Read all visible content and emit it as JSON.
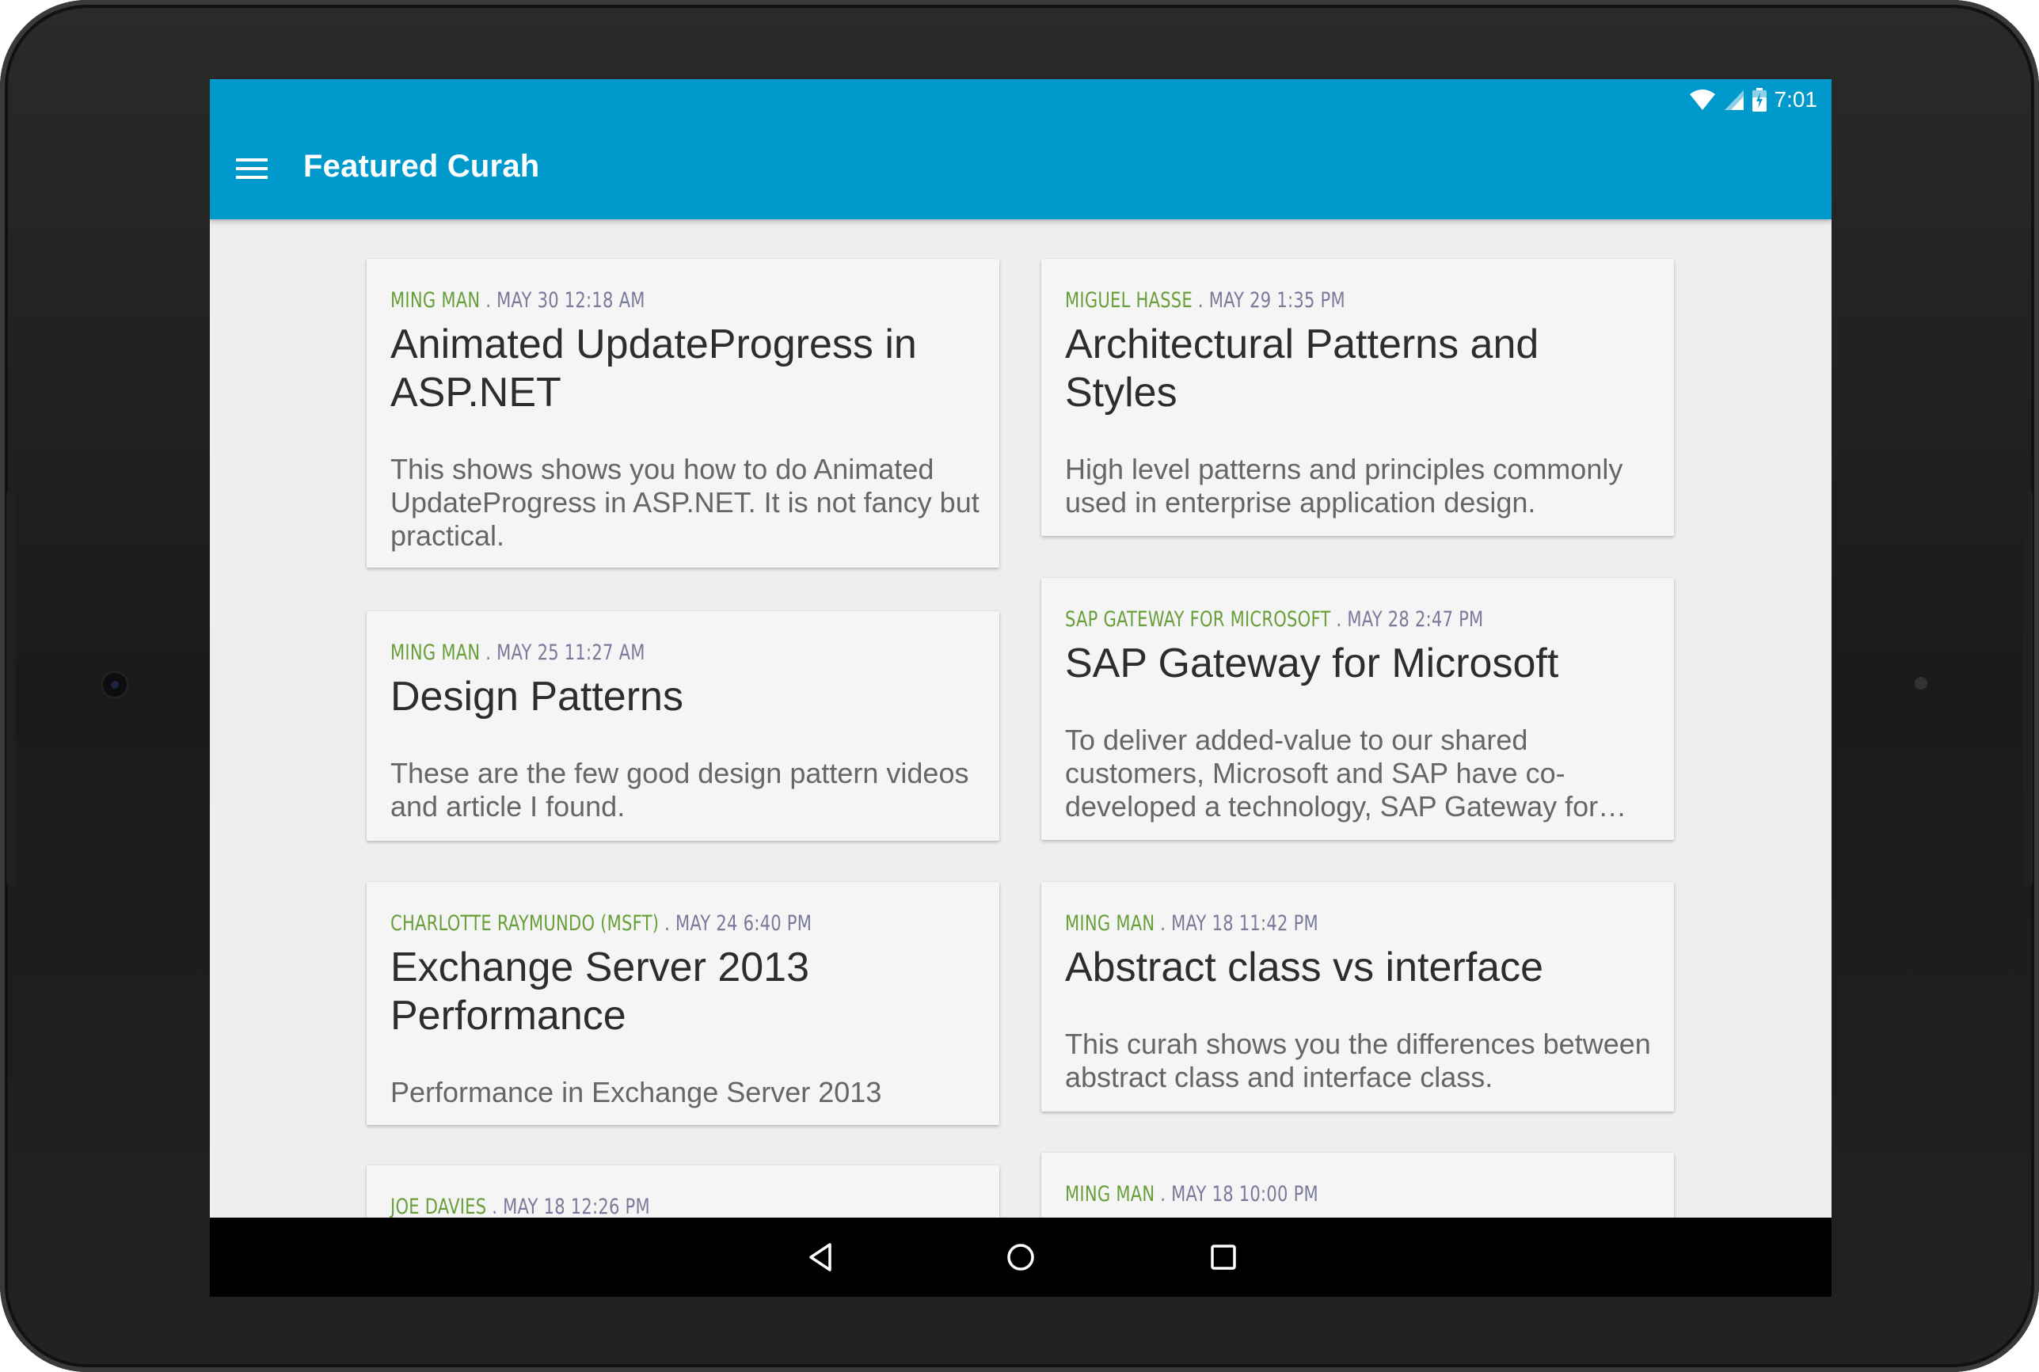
{
  "status_bar": {
    "time": "7:01",
    "icons": [
      "wifi-icon",
      "signal-icon",
      "battery-charging-icon"
    ]
  },
  "app_bar": {
    "title": "Featured Curah",
    "menu_icon": "hamburger-menu-icon"
  },
  "cards": [
    {
      "author": "MING MAN",
      "separator": " . ",
      "date": "MAY 30 12:18 AM",
      "title": "Animated UpdateProgress in ASP.NET",
      "description": "This shows shows you how to do Animated UpdateProgress in ASP.NET. It is not fancy but practical."
    },
    {
      "author": "MIGUEL HASSE",
      "separator": " . ",
      "date": "MAY 29 1:35 PM",
      "title": "Architectural Patterns and Styles",
      "description": "High level patterns and principles commonly used in enterprise application design."
    },
    {
      "author": "MING MAN",
      "separator": " . ",
      "date": "MAY 25 11:27 AM",
      "title": "Design Patterns",
      "description": "These are the few good design pattern videos and article I found."
    },
    {
      "author": "SAP GATEWAY FOR MICROSOFT",
      "separator": " . ",
      "date": "MAY 28 2:47 PM",
      "title": "SAP Gateway for Microsoft",
      "description": "To deliver added-value to our shared customers, Microsoft and SAP have co-developed a technology, SAP Gateway for…"
    },
    {
      "author": "CHARLOTTE RAYMUNDO (MSFT)",
      "separator": " . ",
      "date": "MAY 24 6:40 PM",
      "title": "Exchange Server 2013 Performance",
      "description": "Performance in Exchange Server 2013"
    },
    {
      "author": "MING MAN",
      "separator": " . ",
      "date": "MAY 18 11:42 PM",
      "title": "Abstract class vs interface",
      "description": "This curah shows you the differences between abstract class and interface class."
    },
    {
      "author": "JOE DAVIES",
      "separator": " . ",
      "date": "MAY 18 12:26 PM"
    },
    {
      "author": "MING MAN",
      "separator": " . ",
      "date": "MAY 18 10:00 PM"
    }
  ],
  "nav_bar": {
    "buttons": [
      "back-icon",
      "home-icon",
      "recents-icon"
    ]
  },
  "colors": {
    "app_bar": "#0099cc",
    "author": "#689f38",
    "date": "#7a7a9a",
    "background": "#eeeeee",
    "card": "#f5f5f5"
  }
}
